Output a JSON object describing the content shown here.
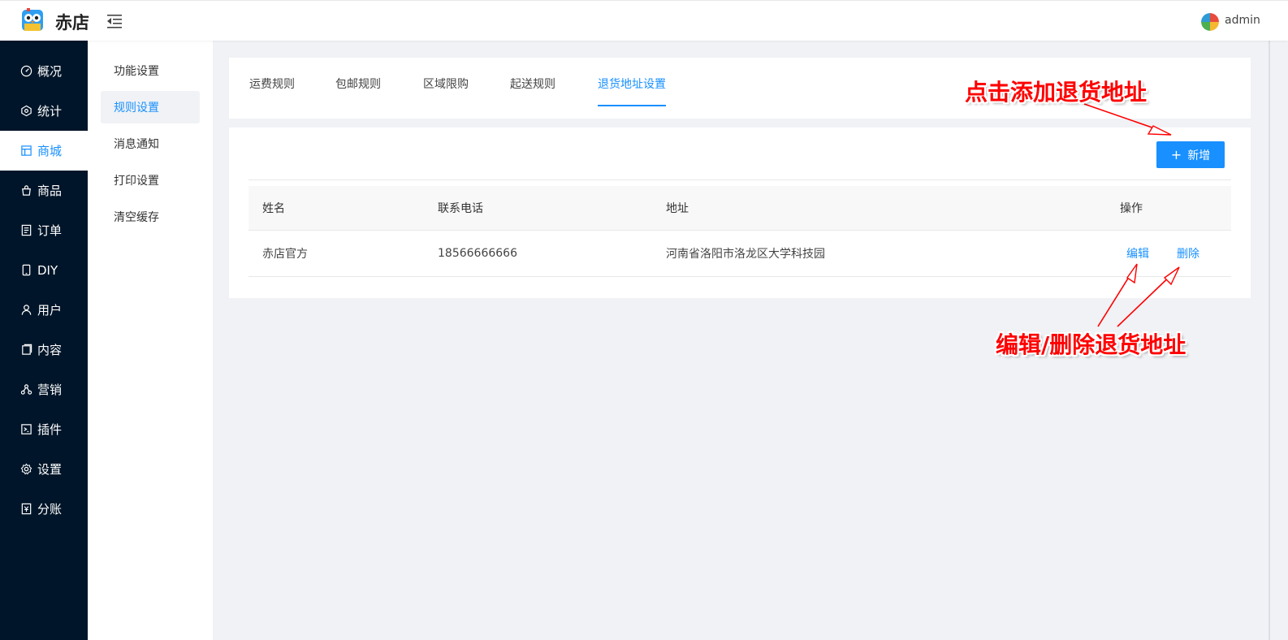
{
  "header": {
    "brand": "赤店",
    "user": "admin"
  },
  "sidebar": {
    "items": [
      {
        "label": "概况",
        "icon": "dashboard-icon"
      },
      {
        "label": "统计",
        "icon": "statistics-icon"
      },
      {
        "label": "商城",
        "icon": "store-icon",
        "active": true
      },
      {
        "label": "商品",
        "icon": "product-icon"
      },
      {
        "label": "订单",
        "icon": "order-icon"
      },
      {
        "label": "DIY",
        "icon": "diy-icon"
      },
      {
        "label": "用户",
        "icon": "user-icon"
      },
      {
        "label": "内容",
        "icon": "content-icon"
      },
      {
        "label": "营销",
        "icon": "marketing-icon"
      },
      {
        "label": "插件",
        "icon": "plugin-icon"
      },
      {
        "label": "设置",
        "icon": "settings-icon"
      },
      {
        "label": "分账",
        "icon": "split-account-icon"
      }
    ]
  },
  "subnav": {
    "items": [
      {
        "label": "功能设置"
      },
      {
        "label": "规则设置",
        "active": true
      },
      {
        "label": "消息通知"
      },
      {
        "label": "打印设置"
      },
      {
        "label": "清空缓存"
      }
    ]
  },
  "tabs": [
    {
      "label": "运费规则"
    },
    {
      "label": "包邮规则"
    },
    {
      "label": "区域限购"
    },
    {
      "label": "起送规则"
    },
    {
      "label": "退货地址设置",
      "active": true
    }
  ],
  "toolbar": {
    "add_label": "新增"
  },
  "table": {
    "columns": [
      "姓名",
      "联系电话",
      "地址",
      "操作"
    ],
    "rows": [
      {
        "name": "赤店官方",
        "phone": "18566666666",
        "address": "河南省洛阳市洛龙区大学科技园",
        "edit": "编辑",
        "delete": "删除"
      }
    ]
  },
  "annotations": {
    "add_hint": "点击添加退货地址",
    "edit_hint": "编辑/删除退货地址"
  },
  "colors": {
    "primary": "#1890ff",
    "sidebar_bg": "#001529",
    "annotation": "#ff0000"
  }
}
